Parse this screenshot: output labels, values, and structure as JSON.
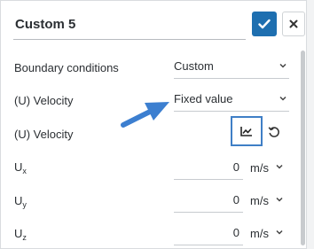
{
  "header": {
    "title": "Custom 5"
  },
  "rows": {
    "boundary": {
      "label": "Boundary conditions",
      "value": "Custom"
    },
    "velocity_type": {
      "label": "(U) Velocity",
      "value": "Fixed value"
    },
    "velocity_table": {
      "label": "(U) Velocity"
    },
    "ux": {
      "label_main": "U",
      "label_sub": "x",
      "value": "0",
      "unit": "m/s"
    },
    "uy": {
      "label_main": "U",
      "label_sub": "y",
      "value": "0",
      "unit": "m/s"
    },
    "uz": {
      "label_main": "U",
      "label_sub": "z",
      "value": "0",
      "unit": "m/s"
    }
  },
  "colors": {
    "accent": "#1e6fb0",
    "highlight": "#3f7fc6",
    "arrow": "#3c7fd0"
  },
  "icons": [
    "check-icon",
    "close-icon",
    "chevron-down-icon",
    "chart-icon",
    "reset-icon",
    "pointer-arrow"
  ]
}
